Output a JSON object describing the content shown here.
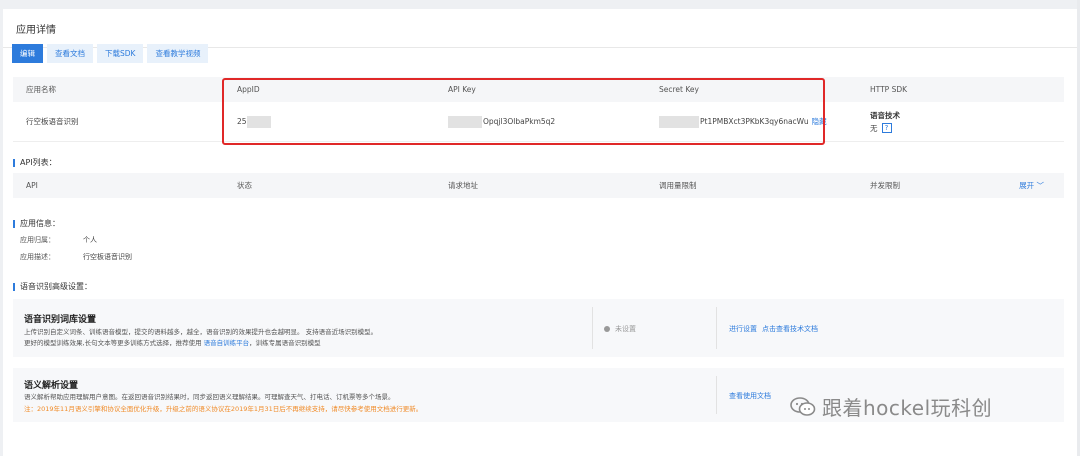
{
  "page": {
    "title": "应用详情"
  },
  "tabs": [
    {
      "label": "编辑"
    },
    {
      "label": "查看文档"
    },
    {
      "label": "下载SDK"
    },
    {
      "label": "查看教学视频"
    }
  ],
  "app_table": {
    "headers": [
      "应用名称",
      "AppID",
      "API Key",
      "Secret Key",
      "HTTP SDK"
    ],
    "row": {
      "name": "行空板语音识别",
      "appid_visible": "25",
      "apikey_visible": "Opqjl3OlbaPkm5q2",
      "secret_visible": "Pt1PMBXct3PKbK3qy6nacWu",
      "secret_hide_link": "隐藏",
      "sdk_title": "语音技术",
      "sdk_value": "无",
      "sdk_help": "?"
    }
  },
  "api_list": {
    "title": "API列表：",
    "headers": [
      "API",
      "状态",
      "请求地址",
      "调用量限制",
      "并发限制"
    ],
    "expand": "展开 ﹀"
  },
  "app_info": {
    "title": "应用信息：",
    "rows": [
      {
        "key": "应用归属：",
        "value": "个人"
      },
      {
        "key": "应用描述：",
        "value": "行空板语音识别"
      }
    ]
  },
  "advanced": {
    "title": "语音识别高级设置：",
    "vocab": {
      "title": "语音识别词库设置",
      "line1": "上传识别自定义词条、训练语音模型，提交的语料越多，越全，语音识别的效果提升也会越明显。 支持语音近场识别模型。",
      "line2_prefix": "更好的模型训练效果,长句文本等更多训练方式选择，推荐使用 ",
      "line2_link": "语音自训练平台",
      "line2_suffix": "，训练专属语音识别模型",
      "status": "未设置",
      "action1": "进行设置",
      "action2": "点击查看技术文档"
    },
    "semantic": {
      "title": "语义解析设置",
      "line1": "语义解析帮助应用理解用户意图。在返回语音识别结果时，同步返回语义理解结果。可理解查天气、打电话、订机票等多个场景。",
      "warn": "注：2019年11月语义引擎和协议全面优化升级，升级之前的语义协议在2019年1月31日后不再继续支持，请尽快参考使用文档进行更新。",
      "action": "查看使用文档"
    }
  },
  "watermark": {
    "text": "跟着hockel玩科创"
  },
  "colors": {
    "accent": "#2d7bdc",
    "highlight_box": "#e02828",
    "warning": "#f08c2a"
  }
}
